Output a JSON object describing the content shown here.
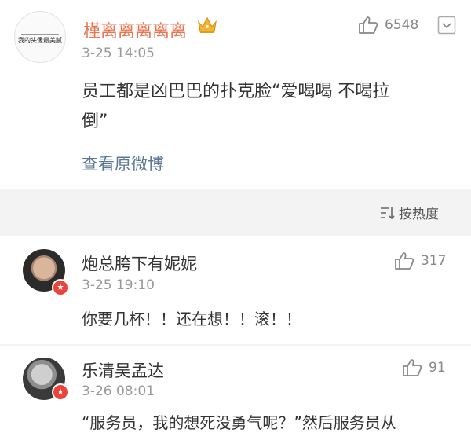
{
  "post": {
    "username": "槿离离离离离",
    "avatar_text": "我的头像最美腻",
    "timestamp": "3-25 14:05",
    "like_count": "6548",
    "content_line1": "员工都是凶巴巴的扑克脸“爱喝喝 不喝拉",
    "content_line2": "倒”",
    "view_original": "查看原微博",
    "icons": {
      "crown": "crown-icon",
      "like": "thumbs-up-icon",
      "more": "chevron-down-icon"
    }
  },
  "sort": {
    "label": "按热度",
    "icon": "sort-icon"
  },
  "comments": [
    {
      "name": "炮总胯下有妮妮",
      "time": "3-25 19:10",
      "likes": "317",
      "text": "你要几杯！！还在想！！滚！！"
    },
    {
      "name": "乐清吴孟达",
      "time": "3-26 08:01",
      "likes": "91",
      "text": "“服务员，我的想死没勇气呢？”然后服务员从"
    }
  ],
  "colors": {
    "username": "#eb7350",
    "link": "#5d7895",
    "muted": "#999999",
    "badge": "#e9433b"
  }
}
